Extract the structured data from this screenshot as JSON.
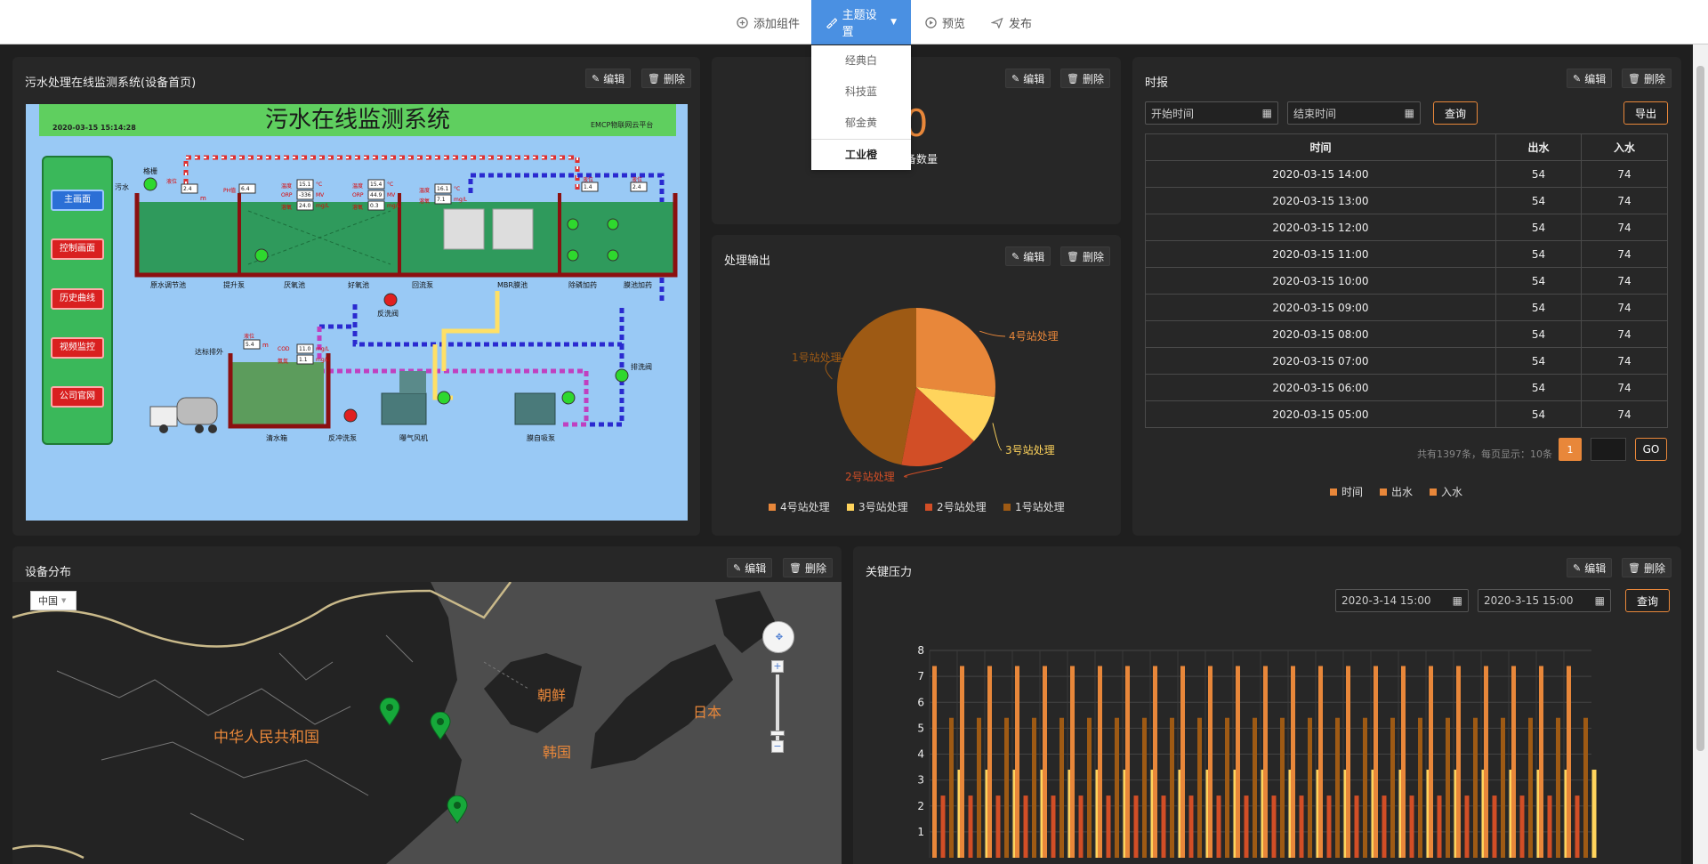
{
  "toolbar": {
    "add": "添加组件",
    "theme": "主题设置",
    "preview": "预览",
    "publish": "发布"
  },
  "theme_menu": [
    "经典白",
    "科技蓝",
    "郁金黄",
    "工业橙"
  ],
  "common": {
    "edit": "编辑",
    "delete": "删除"
  },
  "scada": {
    "title": "污水处理在线监测系统(设备首页)",
    "header": "污水在线监测系统",
    "timestamp": "2020-03-15  15:14:28",
    "brand": "EMCP物联网云平台",
    "nav": [
      "主画面",
      "控制画面",
      "历史曲线",
      "视频监控",
      "公司官网"
    ],
    "labels": {
      "inlet": "污水",
      "grille": "格栅",
      "tank1": "原水调节池",
      "pump1": "提升泵",
      "tank2": "厌氧池",
      "tank3": "好氧池",
      "pump2": "回流泵",
      "mbr": "MBR膜池",
      "dose1": "除磷加药",
      "dose2": "膜池加药",
      "valve1": "反洗阀",
      "outlet": "达标排外",
      "clear": "清水箱",
      "pump3": "反冲洗泵",
      "blower": "曝气风机",
      "pump4": "膜自吸泵",
      "valve2": "排洗阀",
      "liquid": "液位",
      "ph": "PH值",
      "temp": "温度",
      "orp": "ORP",
      "dissolved": "溶氧",
      "cod": "COD",
      "nh": "氨氮",
      "u_m": "m",
      "u_c": "°C",
      "u_mv": "MV",
      "u_mgl": "mg/L"
    },
    "values": {
      "lvl1": "2.4",
      "ph": "6.4",
      "t1": "15.1",
      "orp1": "-336",
      "do1": "24.0",
      "t2": "15.4",
      "orp2": "44.9",
      "do2": "0.3",
      "t3": "16.1",
      "do3": "7.1",
      "lvl2": "1.4",
      "lvl3": "2.4",
      "lvl4": "5.4",
      "cod": "11.0",
      "nh": "1.1"
    }
  },
  "device_count": {
    "value": "0",
    "label": "设备数量"
  },
  "pie": {
    "title": "处理输出",
    "chart_data": {
      "type": "pie",
      "slices": [
        {
          "name": "4号站处理",
          "value": 27,
          "color": "#e8873a"
        },
        {
          "name": "3号站处理",
          "value": 10,
          "color": "#ffd45c"
        },
        {
          "name": "2号站处理",
          "value": 16,
          "color": "#d24e26"
        },
        {
          "name": "1号站处理",
          "value": 47,
          "color": "#9e5a14"
        }
      ]
    }
  },
  "report": {
    "title": "时报",
    "start_placeholder": "开始时间",
    "end_placeholder": "结束时间",
    "query": "查询",
    "export": "导出",
    "headers": [
      "时间",
      "出水",
      "入水"
    ],
    "rows": [
      [
        "2020-03-15 14:00",
        "54",
        "74"
      ],
      [
        "2020-03-15 13:00",
        "54",
        "74"
      ],
      [
        "2020-03-15 12:00",
        "54",
        "74"
      ],
      [
        "2020-03-15 11:00",
        "54",
        "74"
      ],
      [
        "2020-03-15 10:00",
        "54",
        "74"
      ],
      [
        "2020-03-15 09:00",
        "54",
        "74"
      ],
      [
        "2020-03-15 08:00",
        "54",
        "74"
      ],
      [
        "2020-03-15 07:00",
        "54",
        "74"
      ],
      [
        "2020-03-15 06:00",
        "54",
        "74"
      ],
      [
        "2020-03-15 05:00",
        "54",
        "74"
      ]
    ],
    "pagination": "共有1397条，每页显示：10条",
    "page": "1",
    "go": "GO",
    "legend": [
      "时间",
      "出水",
      "入水"
    ]
  },
  "map": {
    "title": "设备分布",
    "select": "中国",
    "labels": [
      "中华人民共和国",
      "朝鲜",
      "韩国",
      "日本"
    ]
  },
  "pressure": {
    "title": "关键压力",
    "start": "2020-3-14 15:00",
    "end": "2020-3-15 15:00",
    "query": "查询",
    "chart_data": {
      "type": "bar",
      "ylim": [
        0,
        8
      ],
      "yticks": [
        1,
        2,
        3,
        4,
        5,
        6,
        7,
        8
      ],
      "group_count": 24,
      "series": [
        {
          "values": [
            7.4,
            7.4,
            7.4,
            7.4,
            7.4,
            7.4,
            7.4,
            7.4,
            7.4,
            7.4,
            7.4,
            7.4,
            7.4,
            7.4,
            7.4,
            7.4,
            7.4,
            7.4,
            7.4,
            7.4,
            7.4,
            7.4,
            7.4,
            7.4
          ],
          "color": "#e8873a"
        },
        {
          "values": [
            2.4,
            2.4,
            2.4,
            2.4,
            2.4,
            2.4,
            2.4,
            2.4,
            2.4,
            2.4,
            2.4,
            2.4,
            2.4,
            2.4,
            2.4,
            2.4,
            2.4,
            2.4,
            2.4,
            2.4,
            2.4,
            2.4,
            2.4,
            2.4
          ],
          "color": "#d24e26"
        },
        {
          "values": [
            5.4,
            5.4,
            5.4,
            5.4,
            5.4,
            5.4,
            5.4,
            5.4,
            5.4,
            5.4,
            5.4,
            5.4,
            5.4,
            5.4,
            5.4,
            5.4,
            5.4,
            5.4,
            5.4,
            5.4,
            5.4,
            5.4,
            5.4,
            5.4
          ],
          "color": "#9e5a14"
        },
        {
          "values": [
            3.4,
            3.4,
            3.4,
            3.4,
            3.4,
            3.4,
            3.4,
            3.4,
            3.4,
            3.4,
            3.4,
            3.4,
            3.4,
            3.4,
            3.4,
            3.4,
            3.4,
            3.4,
            3.4,
            3.4,
            3.4,
            3.4,
            3.4,
            3.4
          ],
          "color": "#ffd45c"
        }
      ]
    }
  }
}
